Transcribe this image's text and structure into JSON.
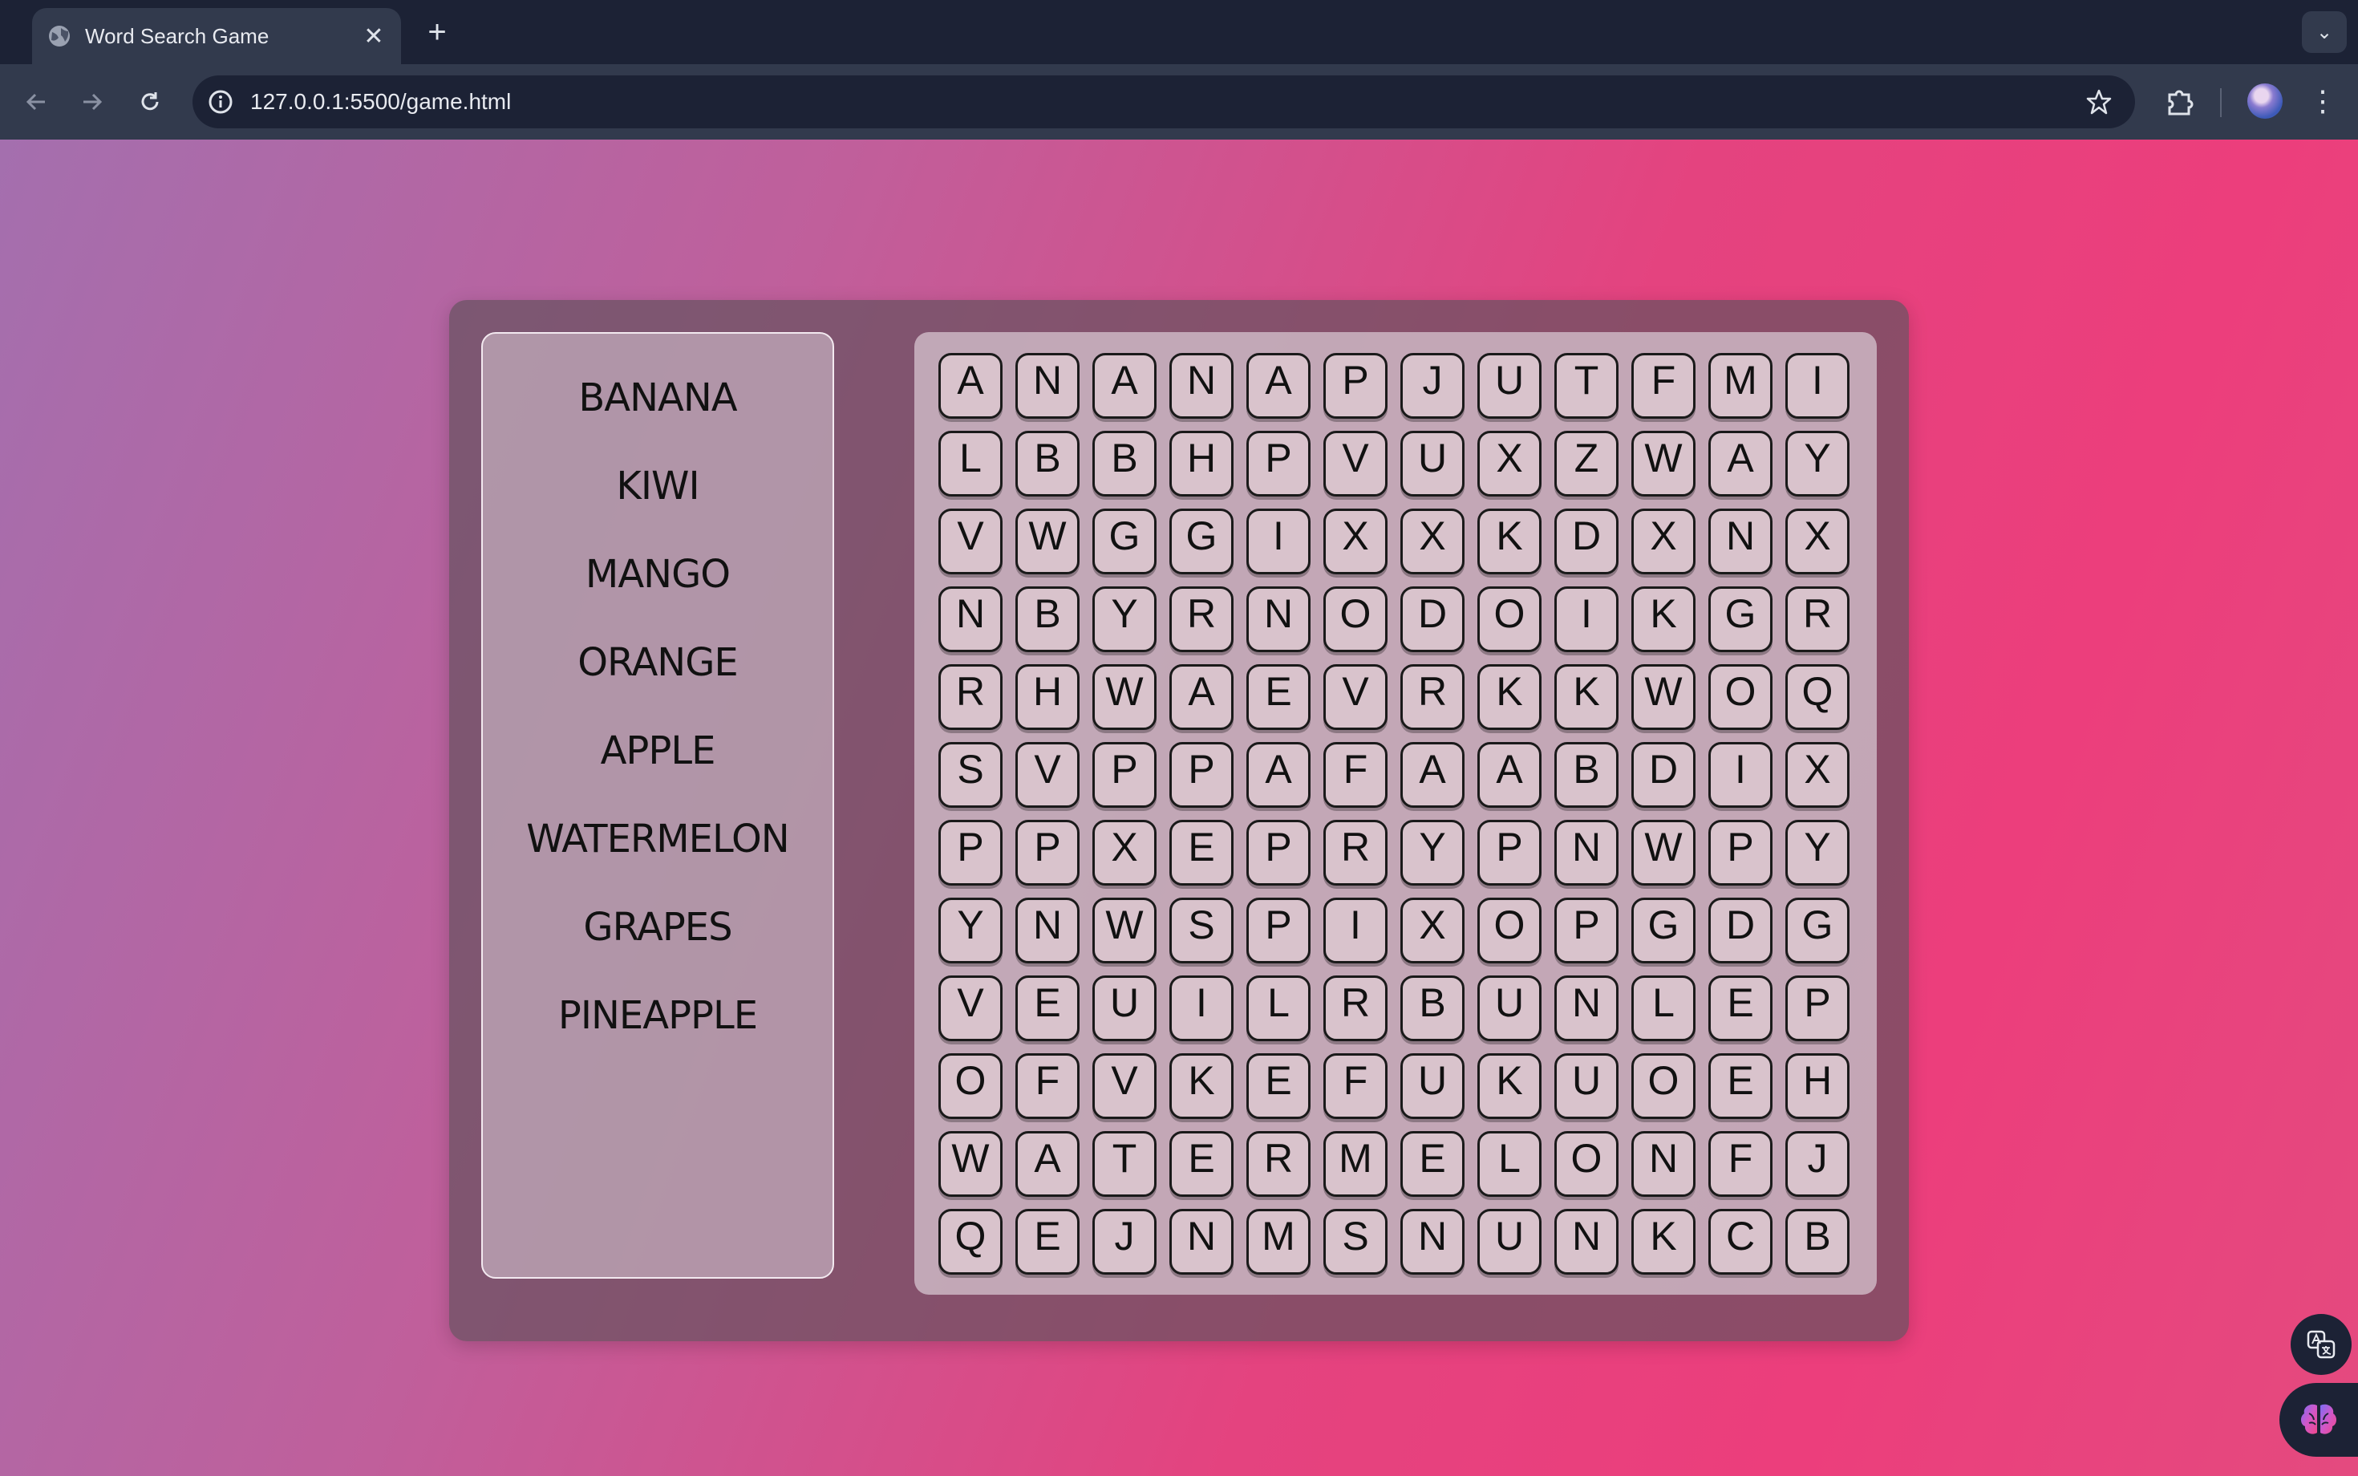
{
  "browser": {
    "tab_title": "Word Search Game",
    "new_tab_label": "+",
    "url": "127.0.0.1:5500/game.html"
  },
  "word_list": [
    "BANANA",
    "KIWI",
    "MANGO",
    "ORANGE",
    "APPLE",
    "WATERMELON",
    "GRAPES",
    "PINEAPPLE"
  ],
  "grid": [
    [
      "A",
      "N",
      "A",
      "N",
      "A",
      "P",
      "J",
      "U",
      "T",
      "F",
      "M",
      "I"
    ],
    [
      "L",
      "B",
      "B",
      "H",
      "P",
      "V",
      "U",
      "X",
      "Z",
      "W",
      "A",
      "Y"
    ],
    [
      "V",
      "W",
      "G",
      "G",
      "I",
      "X",
      "X",
      "K",
      "D",
      "X",
      "N",
      "X"
    ],
    [
      "N",
      "B",
      "Y",
      "R",
      "N",
      "O",
      "D",
      "O",
      "I",
      "K",
      "G",
      "R"
    ],
    [
      "R",
      "H",
      "W",
      "A",
      "E",
      "V",
      "R",
      "K",
      "K",
      "W",
      "O",
      "Q"
    ],
    [
      "S",
      "V",
      "P",
      "P",
      "A",
      "F",
      "A",
      "A",
      "B",
      "D",
      "I",
      "X"
    ],
    [
      "P",
      "P",
      "X",
      "E",
      "P",
      "R",
      "Y",
      "P",
      "N",
      "W",
      "P",
      "Y"
    ],
    [
      "Y",
      "N",
      "W",
      "S",
      "P",
      "I",
      "X",
      "O",
      "P",
      "G",
      "D",
      "G"
    ],
    [
      "V",
      "E",
      "U",
      "I",
      "L",
      "R",
      "B",
      "U",
      "N",
      "L",
      "E",
      "P"
    ],
    [
      "O",
      "F",
      "V",
      "K",
      "E",
      "F",
      "U",
      "K",
      "U",
      "O",
      "E",
      "H"
    ],
    [
      "W",
      "A",
      "T",
      "E",
      "R",
      "M",
      "E",
      "L",
      "O",
      "N",
      "F",
      "J"
    ],
    [
      "Q",
      "E",
      "J",
      "N",
      "M",
      "S",
      "N",
      "U",
      "N",
      "K",
      "C",
      "B"
    ]
  ],
  "colors": {
    "page_gradient": [
      "#a46fae",
      "#e4437f"
    ],
    "cell_bg": "#d9c3cc",
    "board_bg": "#d4c0cc",
    "panel_bg": "#675260"
  },
  "icons": {
    "tab": "globe-icon",
    "address": "site-info-icon",
    "bookmark": "star-icon",
    "extensions": "puzzle-icon",
    "fab_translate": "translate-icon",
    "fab_brain": "brain-icon"
  }
}
